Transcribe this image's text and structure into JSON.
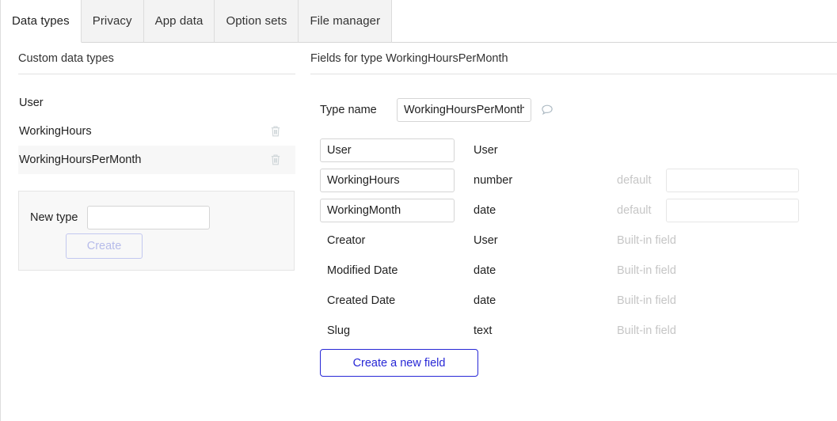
{
  "tabs": [
    {
      "label": "Data types",
      "active": true
    },
    {
      "label": "Privacy",
      "active": false
    },
    {
      "label": "App data",
      "active": false
    },
    {
      "label": "Option sets",
      "active": false
    },
    {
      "label": "File manager",
      "active": false
    }
  ],
  "left_panel": {
    "title": "Custom data types",
    "types": [
      {
        "name": "User",
        "selected": false,
        "deletable": false
      },
      {
        "name": "WorkingHours",
        "selected": false,
        "deletable": true
      },
      {
        "name": "WorkingHoursPerMonth",
        "selected": true,
        "deletable": true
      }
    ],
    "new_type": {
      "label": "New type",
      "value": "",
      "placeholder": "",
      "create_label": "Create",
      "create_disabled": true
    }
  },
  "right_panel": {
    "title": "Fields for type WorkingHoursPerMonth",
    "type_name": {
      "label": "Type name",
      "value": "WorkingHoursPerMonth"
    },
    "comment_icon": "comment-bubble-icon",
    "default_placeholder": "default",
    "builtin_text": "Built-in field",
    "fields": [
      {
        "name": "User",
        "type": "User",
        "editable": true,
        "has_default": false,
        "builtin": false
      },
      {
        "name": "WorkingHours",
        "type": "number",
        "editable": true,
        "has_default": true,
        "default_value": "",
        "builtin": false
      },
      {
        "name": "WorkingMonth",
        "type": "date",
        "editable": true,
        "has_default": true,
        "default_value": "",
        "builtin": false
      },
      {
        "name": "Creator",
        "type": "User",
        "editable": false,
        "has_default": false,
        "builtin": true
      },
      {
        "name": "Modified Date",
        "type": "date",
        "editable": false,
        "has_default": false,
        "builtin": true
      },
      {
        "name": "Created Date",
        "type": "date",
        "editable": false,
        "has_default": false,
        "builtin": true
      },
      {
        "name": "Slug",
        "type": "text",
        "editable": false,
        "has_default": false,
        "builtin": true
      }
    ],
    "create_field_label": "Create a new field"
  },
  "colors": {
    "accent_blue": "#2727d6",
    "disabled_purple": "#b6bbea",
    "muted_gray": "#c6c6c6",
    "selected_row": "#f7f7f7",
    "tab_inactive": "#f3f3f3"
  }
}
